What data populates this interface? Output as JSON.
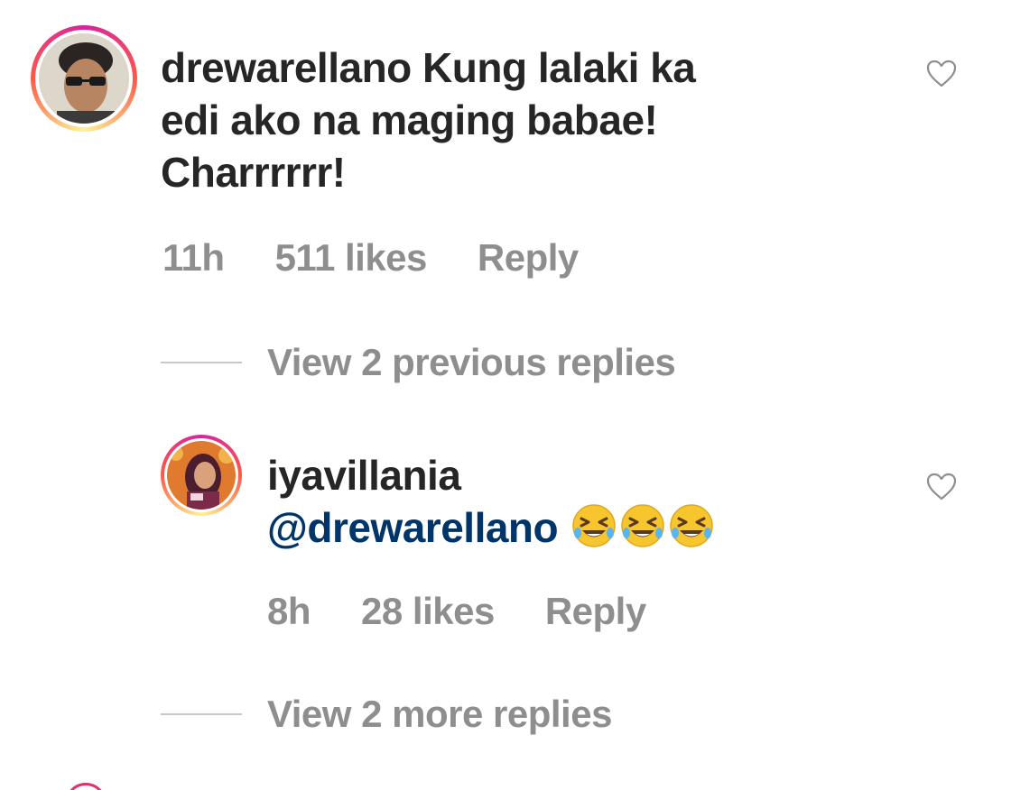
{
  "comment1": {
    "username": "drewarellano",
    "text_line1": " Kung lalaki ka",
    "text_line2": "edi ako na maging babae!",
    "text_line3": "Charrrrrr!",
    "time": "11h",
    "likes": "511 likes",
    "reply_label": "Reply"
  },
  "view_previous": {
    "label": "View 2 previous replies"
  },
  "comment2": {
    "username": "iyavillania",
    "mention": "@drewarellano",
    "emoji": "rolling-on-floor-laughing",
    "time": "8h",
    "likes": "28 likes",
    "reply_label": "Reply"
  },
  "view_more": {
    "label": "View 2 more replies"
  },
  "colors": {
    "text": "#262626",
    "muted": "#8e8e8e",
    "mention": "#003569",
    "ring": "#d6249f"
  }
}
